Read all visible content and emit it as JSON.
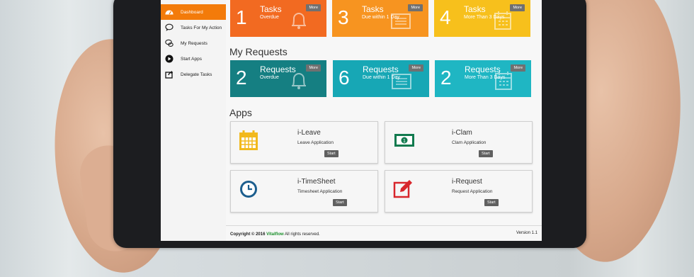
{
  "sidebar": {
    "items": [
      {
        "label": "Dashboard",
        "icon": "dashboard-icon",
        "active": true
      },
      {
        "label": "Tasks For My Action",
        "icon": "chat-bubble-icon",
        "active": false
      },
      {
        "label": "My Requests",
        "icon": "chat-bubbles-icon",
        "active": false
      },
      {
        "label": "Start Apps",
        "icon": "play-icon",
        "active": false
      },
      {
        "label": "Delegate Tasks",
        "icon": "share-icon",
        "active": false
      }
    ]
  },
  "tasks": [
    {
      "count": "1",
      "title": "Tasks",
      "subtitle": "Overdue",
      "more": "More",
      "icon": "bell-icon",
      "color": "#f26a21"
    },
    {
      "count": "3",
      "title": "Tasks",
      "subtitle": "Due within 1 Day",
      "more": "More",
      "icon": "list-icon",
      "color": "#f79420"
    },
    {
      "count": "4",
      "title": "Tasks",
      "subtitle": "More Than 3 Days",
      "more": "More",
      "icon": "calendar-icon",
      "color": "#f7c01c"
    }
  ],
  "my_requests": {
    "title": "My Requests",
    "tiles": [
      {
        "count": "2",
        "title": "Requests",
        "subtitle": "Overdue",
        "more": "More",
        "icon": "bell-icon",
        "color": "#157f82"
      },
      {
        "count": "6",
        "title": "Requests",
        "subtitle": "Due within 1 Day",
        "more": "More",
        "icon": "list-icon",
        "color": "#17a7b5"
      },
      {
        "count": "2",
        "title": "Requests",
        "subtitle": "More Than 3 Days",
        "more": "More",
        "icon": "calendar-icon",
        "color": "#1fb6c3"
      }
    ]
  },
  "apps": {
    "title": "Apps",
    "items": [
      {
        "name": "i-Leave",
        "desc": "Leave Application",
        "start": "Start",
        "icon": "calendar-icon",
        "color": "#f2b91c"
      },
      {
        "name": "i-Clam",
        "desc": "Clam Application",
        "start": "Start",
        "icon": "money-icon",
        "color": "#117a4e"
      },
      {
        "name": "i-TimeSheet",
        "desc": "Timesheet Application",
        "start": "Start",
        "icon": "clock-icon",
        "color": "#1c5e8e"
      },
      {
        "name": "i-Request",
        "desc": "Request Application",
        "start": "Start",
        "icon": "edit-icon",
        "color": "#d8262c"
      }
    ]
  },
  "footer": {
    "copyright_prefix": "Copyright © 2016",
    "brand": "Vitalflow",
    "copyright_suffix": "All rights reserved.",
    "version": "Version 1.1"
  }
}
